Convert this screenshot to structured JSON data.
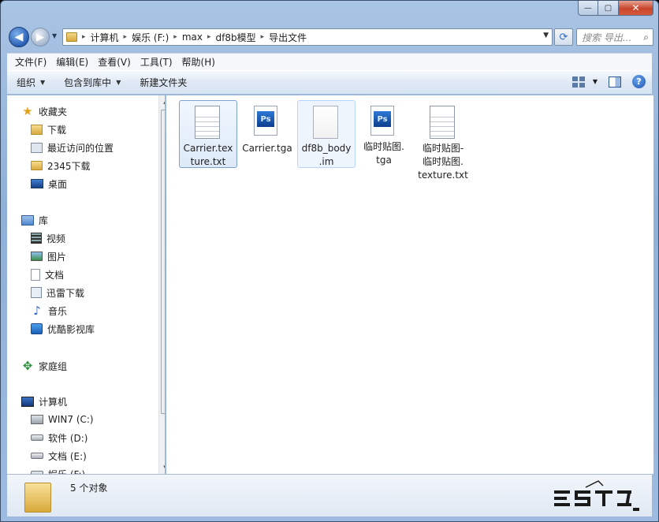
{
  "window": {
    "minimize_glyph": "—",
    "maximize_glyph": "▢",
    "close_glyph": "✕"
  },
  "address_bar": {
    "breadcrumbs": [
      "计算机",
      "娱乐 (F:)",
      "max",
      "df8b模型",
      "导出文件"
    ],
    "separator": "▸"
  },
  "search": {
    "placeholder": "搜索 导出..."
  },
  "menu": [
    "文件(F)",
    "编辑(E)",
    "查看(V)",
    "工具(T)",
    "帮助(H)"
  ],
  "toolbar": {
    "organize": "组织",
    "include_in_library": "包含到库中",
    "new_folder": "新建文件夹"
  },
  "nav_pane": {
    "favorites": {
      "label": "收藏夹",
      "items": [
        "下载",
        "最近访问的位置",
        "2345下载",
        "桌面"
      ]
    },
    "libraries": {
      "label": "库",
      "items": [
        "视频",
        "图片",
        "文档",
        "迅雷下载",
        "音乐",
        "优酷影视库"
      ]
    },
    "homegroup": {
      "label": "家庭组"
    },
    "computer": {
      "label": "计算机",
      "items": [
        "WIN7 (C:)",
        "软件 (D:)",
        "文档 (E:)",
        "娱乐 (F:)"
      ]
    }
  },
  "files": [
    {
      "name": "Carrier.texture.txt",
      "lines": [
        "Carrier.tex",
        "ture.txt"
      ],
      "icon": "text-file-icon",
      "state": "selected"
    },
    {
      "name": "Carrier.tga",
      "lines": [
        "Carrier.tga"
      ],
      "icon": "photoshop-file-icon",
      "state": "normal"
    },
    {
      "name": "df8b_body.im",
      "lines": [
        "df8b_body",
        ".im"
      ],
      "icon": "blank-file-icon",
      "state": "hover"
    },
    {
      "name": "临时贴图.tga",
      "lines": [
        "临时贴图.",
        "tga"
      ],
      "icon": "photoshop-file-icon",
      "state": "normal"
    },
    {
      "name": "临时贴图-临时贴图.texture.txt",
      "lines": [
        "临时贴图-",
        "临时贴图.",
        "texture.txt"
      ],
      "icon": "text-file-icon",
      "state": "normal"
    }
  ],
  "status": {
    "count_text": "5 个对象"
  },
  "watermark": {
    "text": "ESTD"
  }
}
